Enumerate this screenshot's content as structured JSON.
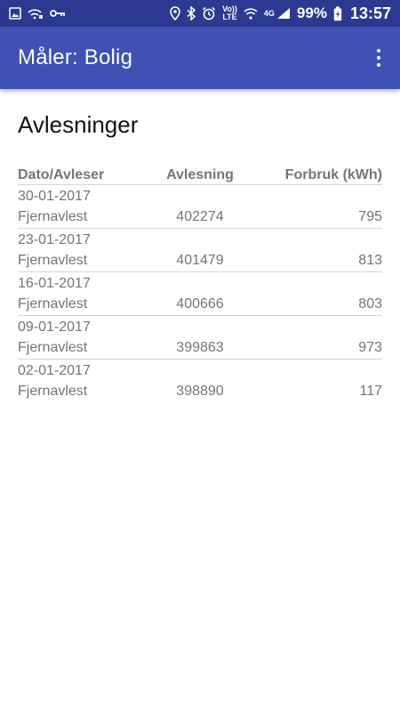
{
  "status_bar": {
    "left_icons": [
      "image-icon",
      "wifi-calling-icon",
      "key-icon"
    ],
    "right_icons": [
      "location-icon",
      "bluetooth-icon",
      "alarm-icon",
      "volte-icon",
      "wifi-icon",
      "signal-icon",
      "battery-charging-icon"
    ],
    "volte_label_top": "Vo))",
    "volte_label_bottom": "LTE",
    "network_type": "4G",
    "battery_percent": "99%",
    "time": "13:57"
  },
  "app_bar": {
    "title": "Måler: Bolig",
    "overflow_icon": "more-vert-icon"
  },
  "main": {
    "section_title": "Avlesninger",
    "table": {
      "headers": {
        "date_reader": "Dato/Avleser",
        "reading": "Avlesning",
        "consumption": "Forbruk (kWh)"
      },
      "rows": [
        {
          "date": "30-01-2017",
          "reader": "Fjernavlest",
          "reading": "402274",
          "consumption": "795"
        },
        {
          "date": "23-01-2017",
          "reader": "Fjernavlest",
          "reading": "401479",
          "consumption": "813"
        },
        {
          "date": "16-01-2017",
          "reader": "Fjernavlest",
          "reading": "400666",
          "consumption": "803"
        },
        {
          "date": "09-01-2017",
          "reader": "Fjernavlest",
          "reading": "399863",
          "consumption": "973"
        },
        {
          "date": "02-01-2017",
          "reader": "Fjernavlest",
          "reading": "398890",
          "consumption": "117"
        }
      ]
    }
  },
  "colors": {
    "status_bar": "#2b3990",
    "app_bar": "#3f51b5",
    "text_secondary": "#757575",
    "divider": "#d6d6d6"
  }
}
